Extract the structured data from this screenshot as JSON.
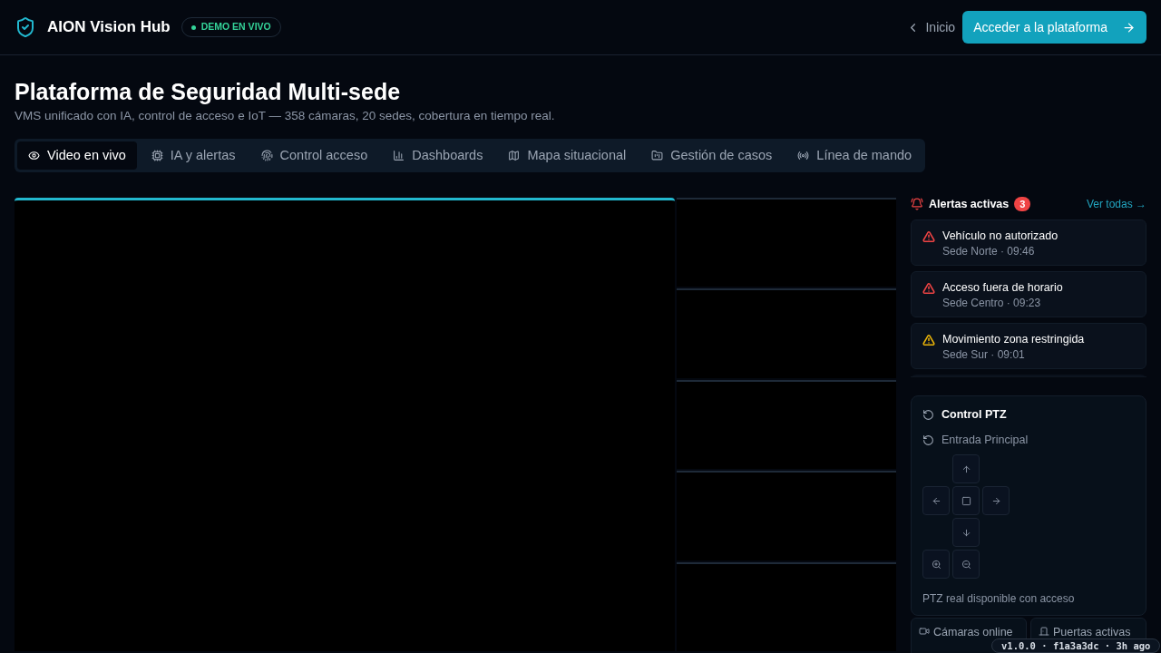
{
  "header": {
    "brand": "AION Vision Hub",
    "badge": "DEMO EN VIVO",
    "back_link": "Inicio",
    "cta": "Acceder a la plataforma"
  },
  "page": {
    "title": "Plataforma de Seguridad Multi-sede",
    "subtitle": "VMS unificado con IA, control de acceso e IoT — 358 cámaras, 20 sedes, cobertura en tiempo real."
  },
  "tabs": [
    {
      "label": "Video en vivo",
      "selected": true
    },
    {
      "label": "IA y alertas",
      "selected": false
    },
    {
      "label": "Control acceso",
      "selected": false
    },
    {
      "label": "Dashboards",
      "selected": false
    },
    {
      "label": "Mapa situacional",
      "selected": false
    },
    {
      "label": "Gestión de casos",
      "selected": false
    },
    {
      "label": "Línea de mando",
      "selected": false
    }
  ],
  "video_tiles": [
    {
      "selected": true
    },
    {
      "selected": false
    },
    {
      "selected": false
    },
    {
      "selected": false
    },
    {
      "selected": false
    },
    {
      "selected": false
    }
  ],
  "alerts": {
    "title": "Alertas activas",
    "count": "3",
    "link": "Ver todas →",
    "items": [
      {
        "title": "Vehículo no autorizado",
        "meta": "Sede Norte · 09:46",
        "color": "#ef4444"
      },
      {
        "title": "Acceso fuera de horario",
        "meta": "Sede Centro · 09:23",
        "color": "#ef4444"
      },
      {
        "title": "Movimiento zona restringida",
        "meta": "Sede Sur · 09:01",
        "color": "#eab308"
      }
    ]
  },
  "ptz": {
    "title": "Control PTZ",
    "camera": "Entrada Principal",
    "note": "PTZ real disponible con acceso"
  },
  "stats": [
    {
      "label": "Cámaras online"
    },
    {
      "label": "Puertas activas"
    }
  ],
  "version_badge": "v1.0.0 · f1a3a3dc · 3h ago"
}
